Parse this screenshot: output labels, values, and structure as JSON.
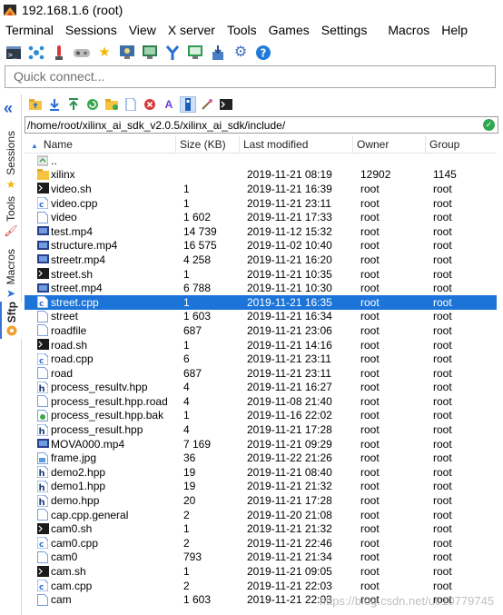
{
  "window": {
    "title": "192.168.1.6 (root)"
  },
  "menu": [
    "Terminal",
    "Sessions",
    "View",
    "X server",
    "Tools",
    "Games",
    "Settings",
    "Macros",
    "Help"
  ],
  "toolbar_icons": [
    "terminal-icon",
    "sessions-icon",
    "servers-icon",
    "tools-icon",
    "games-icon",
    "sessions-manager-icon",
    "view-icon",
    "split-icon",
    "multiexec-icon",
    "tunneling-icon",
    "packages-icon",
    "settings-icon",
    "help-icon"
  ],
  "quick_connect": {
    "placeholder": "Quick connect..."
  },
  "side_tabs": {
    "sessions": "Sessions",
    "tools": "Tools",
    "macros": "Macros",
    "sftp": "Sftp"
  },
  "sftp": {
    "toolbar_icons": [
      "folder-up-icon",
      "download-icon",
      "upload-icon",
      "refresh-icon",
      "new-folder-icon",
      "new-file-icon",
      "delete-icon",
      "rename-icon",
      "hidden-files-icon",
      "properties-icon",
      "terminal-follow-icon"
    ],
    "path": "/home/root/xilinx_ai_sdk_v2.0.5/xilinx_ai_sdk/include/",
    "columns": {
      "name": "Name",
      "size": "Size (KB)",
      "modified": "Last modified",
      "owner": "Owner",
      "group": "Group"
    },
    "files": [
      {
        "name": "..",
        "size": "",
        "modified": "",
        "owner": "",
        "group": "",
        "type": "parent"
      },
      {
        "name": "xilinx",
        "size": "",
        "modified": "2019-11-21 08:19",
        "owner": "12902",
        "group": "1145",
        "type": "folder"
      },
      {
        "name": "video.sh",
        "size": "1",
        "modified": "2019-11-21 16:39",
        "owner": "root",
        "group": "root",
        "type": "sh"
      },
      {
        "name": "video.cpp",
        "size": "1",
        "modified": "2019-11-21 23:11",
        "owner": "root",
        "group": "root",
        "type": "cpp"
      },
      {
        "name": "video",
        "size": "1 602",
        "modified": "2019-11-21 17:33",
        "owner": "root",
        "group": "root",
        "type": "file"
      },
      {
        "name": "test.mp4",
        "size": "14 739",
        "modified": "2019-11-12 15:32",
        "owner": "root",
        "group": "root",
        "type": "video"
      },
      {
        "name": "structure.mp4",
        "size": "16 575",
        "modified": "2019-11-02 10:40",
        "owner": "root",
        "group": "root",
        "type": "video"
      },
      {
        "name": "streetr.mp4",
        "size": "4 258",
        "modified": "2019-11-21 16:20",
        "owner": "root",
        "group": "root",
        "type": "video"
      },
      {
        "name": "street.sh",
        "size": "1",
        "modified": "2019-11-21 10:35",
        "owner": "root",
        "group": "root",
        "type": "sh"
      },
      {
        "name": "street.mp4",
        "size": "6 788",
        "modified": "2019-11-21 10:30",
        "owner": "root",
        "group": "root",
        "type": "video"
      },
      {
        "name": "street.cpp",
        "size": "1",
        "modified": "2019-11-21 16:35",
        "owner": "root",
        "group": "root",
        "type": "cpp",
        "selected": true
      },
      {
        "name": "street",
        "size": "1 603",
        "modified": "2019-11-21 16:34",
        "owner": "root",
        "group": "root",
        "type": "file"
      },
      {
        "name": "roadfile",
        "size": "687",
        "modified": "2019-11-21 23:06",
        "owner": "root",
        "group": "root",
        "type": "file"
      },
      {
        "name": "road.sh",
        "size": "1",
        "modified": "2019-11-21 14:16",
        "owner": "root",
        "group": "root",
        "type": "sh"
      },
      {
        "name": "road.cpp",
        "size": "6",
        "modified": "2019-11-21 23:11",
        "owner": "root",
        "group": "root",
        "type": "cpp"
      },
      {
        "name": "road",
        "size": "687",
        "modified": "2019-11-21 23:11",
        "owner": "root",
        "group": "root",
        "type": "file"
      },
      {
        "name": "process_resultv.hpp",
        "size": "4",
        "modified": "2019-11-21 16:27",
        "owner": "root",
        "group": "root",
        "type": "hpp"
      },
      {
        "name": "process_result.hpp.road",
        "size": "4",
        "modified": "2019-11-08 21:40",
        "owner": "root",
        "group": "root",
        "type": "file"
      },
      {
        "name": "process_result.hpp.bak",
        "size": "1",
        "modified": "2019-11-16 22:02",
        "owner": "root",
        "group": "root",
        "type": "bak"
      },
      {
        "name": "process_result.hpp",
        "size": "4",
        "modified": "2019-11-21 17:28",
        "owner": "root",
        "group": "root",
        "type": "hpp"
      },
      {
        "name": "MOVA000.mp4",
        "size": "7 169",
        "modified": "2019-11-21 09:29",
        "owner": "root",
        "group": "root",
        "type": "video"
      },
      {
        "name": "frame.jpg",
        "size": "36",
        "modified": "2019-11-22 21:26",
        "owner": "root",
        "group": "root",
        "type": "image"
      },
      {
        "name": "demo2.hpp",
        "size": "19",
        "modified": "2019-11-21 08:40",
        "owner": "root",
        "group": "root",
        "type": "hpp"
      },
      {
        "name": "demo1.hpp",
        "size": "19",
        "modified": "2019-11-21 21:32",
        "owner": "root",
        "group": "root",
        "type": "hpp"
      },
      {
        "name": "demo.hpp",
        "size": "20",
        "modified": "2019-11-21 17:28",
        "owner": "root",
        "group": "root",
        "type": "hpp"
      },
      {
        "name": "cap.cpp.general",
        "size": "2",
        "modified": "2019-11-20 21:08",
        "owner": "root",
        "group": "root",
        "type": "file"
      },
      {
        "name": "cam0.sh",
        "size": "1",
        "modified": "2019-11-21 21:32",
        "owner": "root",
        "group": "root",
        "type": "sh"
      },
      {
        "name": "cam0.cpp",
        "size": "2",
        "modified": "2019-11-21 22:46",
        "owner": "root",
        "group": "root",
        "type": "cpp"
      },
      {
        "name": "cam0",
        "size": "793",
        "modified": "2019-11-21 21:34",
        "owner": "root",
        "group": "root",
        "type": "file"
      },
      {
        "name": "cam.sh",
        "size": "1",
        "modified": "2019-11-21 09:05",
        "owner": "root",
        "group": "root",
        "type": "sh"
      },
      {
        "name": "cam.cpp",
        "size": "2",
        "modified": "2019-11-21 22:03",
        "owner": "root",
        "group": "root",
        "type": "cpp"
      },
      {
        "name": "cam",
        "size": "1 603",
        "modified": "2019-11-21 22:03",
        "owner": "root",
        "group": "root",
        "type": "file"
      }
    ]
  },
  "watermark": "https://blog.csdn.net/u010779745",
  "colors": {
    "selection": "#1c74d8",
    "accent": "#3a73d8",
    "folder": "#f5c242"
  }
}
